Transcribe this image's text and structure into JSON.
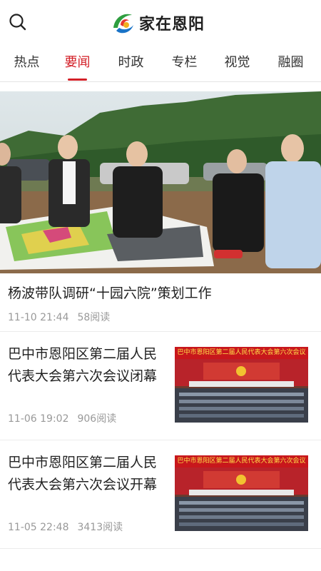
{
  "header": {
    "logo_text": "家在恩阳",
    "search_icon": "search-icon"
  },
  "tabs": [
    {
      "label": "热点",
      "active": false
    },
    {
      "label": "要闻",
      "active": true
    },
    {
      "label": "时政",
      "active": false
    },
    {
      "label": "专栏",
      "active": false
    },
    {
      "label": "视觉",
      "active": false
    },
    {
      "label": "融圈",
      "active": false
    }
  ],
  "colors": {
    "accent": "#d32028",
    "meta": "#999999",
    "banner_red": "#c8171c"
  },
  "featured": {
    "title": "杨波带队调研“十园六院”策划工作",
    "time": "11-10 21:44",
    "views": "58阅读"
  },
  "articles": [
    {
      "title": "巴中市恩阳区第二届人民代表大会第六次会议闭幕",
      "time": "11-06 19:02",
      "views": "906阅读",
      "thumb_banner": "巴中市恩阳区第二届人民代表大会第六次会议"
    },
    {
      "title": "巴中市恩阳区第二届人民代表大会第六次会议开幕",
      "time": "11-05 22:48",
      "views": "3413阅读",
      "thumb_banner": "巴中市恩阳区第二届人民代表大会第六次会议"
    }
  ]
}
